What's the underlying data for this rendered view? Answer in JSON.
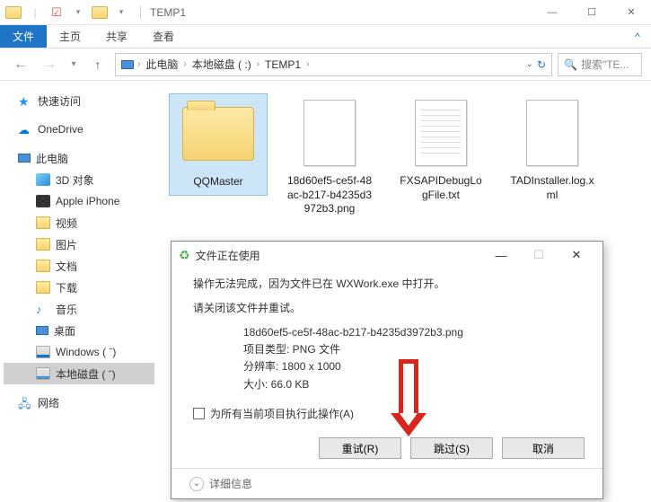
{
  "window": {
    "title": "TEMP1",
    "controls": {
      "min": "—",
      "max": "☐",
      "close": "✕"
    }
  },
  "ribbon": {
    "file": "文件",
    "tabs": [
      "主页",
      "共享",
      "查看"
    ]
  },
  "breadcrumb": {
    "items": [
      "此电脑",
      "本地磁盘 ( :)",
      "TEMP1"
    ],
    "search_placeholder": "搜索\"TE..."
  },
  "sidebar": {
    "quick": "快速访问",
    "onedrive": "OneDrive",
    "pc": "此电脑",
    "items": [
      "3D 对象",
      "Apple iPhone",
      "视频",
      "图片",
      "文档",
      "下载",
      "音乐",
      "桌面",
      "Windows ( ˉ)",
      "本地磁盘 ( ˉ)"
    ],
    "network": "网络"
  },
  "files": [
    {
      "name": "QQMaster",
      "type": "folder"
    },
    {
      "name": "18d60ef5-ce5f-48ac-b217-b4235d3972b3.png",
      "type": "file"
    },
    {
      "name": "FXSAPIDebugLogFile.txt",
      "type": "file"
    },
    {
      "name": "TADInstaller.log.xml",
      "type": "file"
    }
  ],
  "dialog": {
    "title": "文件正在使用",
    "line1": "操作无法完成，因为文件已在 WXWork.exe 中打开。",
    "line2": "请关闭该文件并重试。",
    "filename": "18d60ef5-ce5f-48ac-b217-b4235d3972b3.png",
    "type_label": "项目类型: PNG 文件",
    "resolution": "分辨率: 1800 x 1000",
    "size": "大小: 66.0 KB",
    "checkbox": "为所有当前项目执行此操作(A)",
    "buttons": {
      "retry": "重试(R)",
      "skip": "跳过(S)",
      "cancel": "取消"
    },
    "more": "详细信息",
    "controls": {
      "min": "—",
      "max": "☐",
      "close": "✕"
    }
  }
}
